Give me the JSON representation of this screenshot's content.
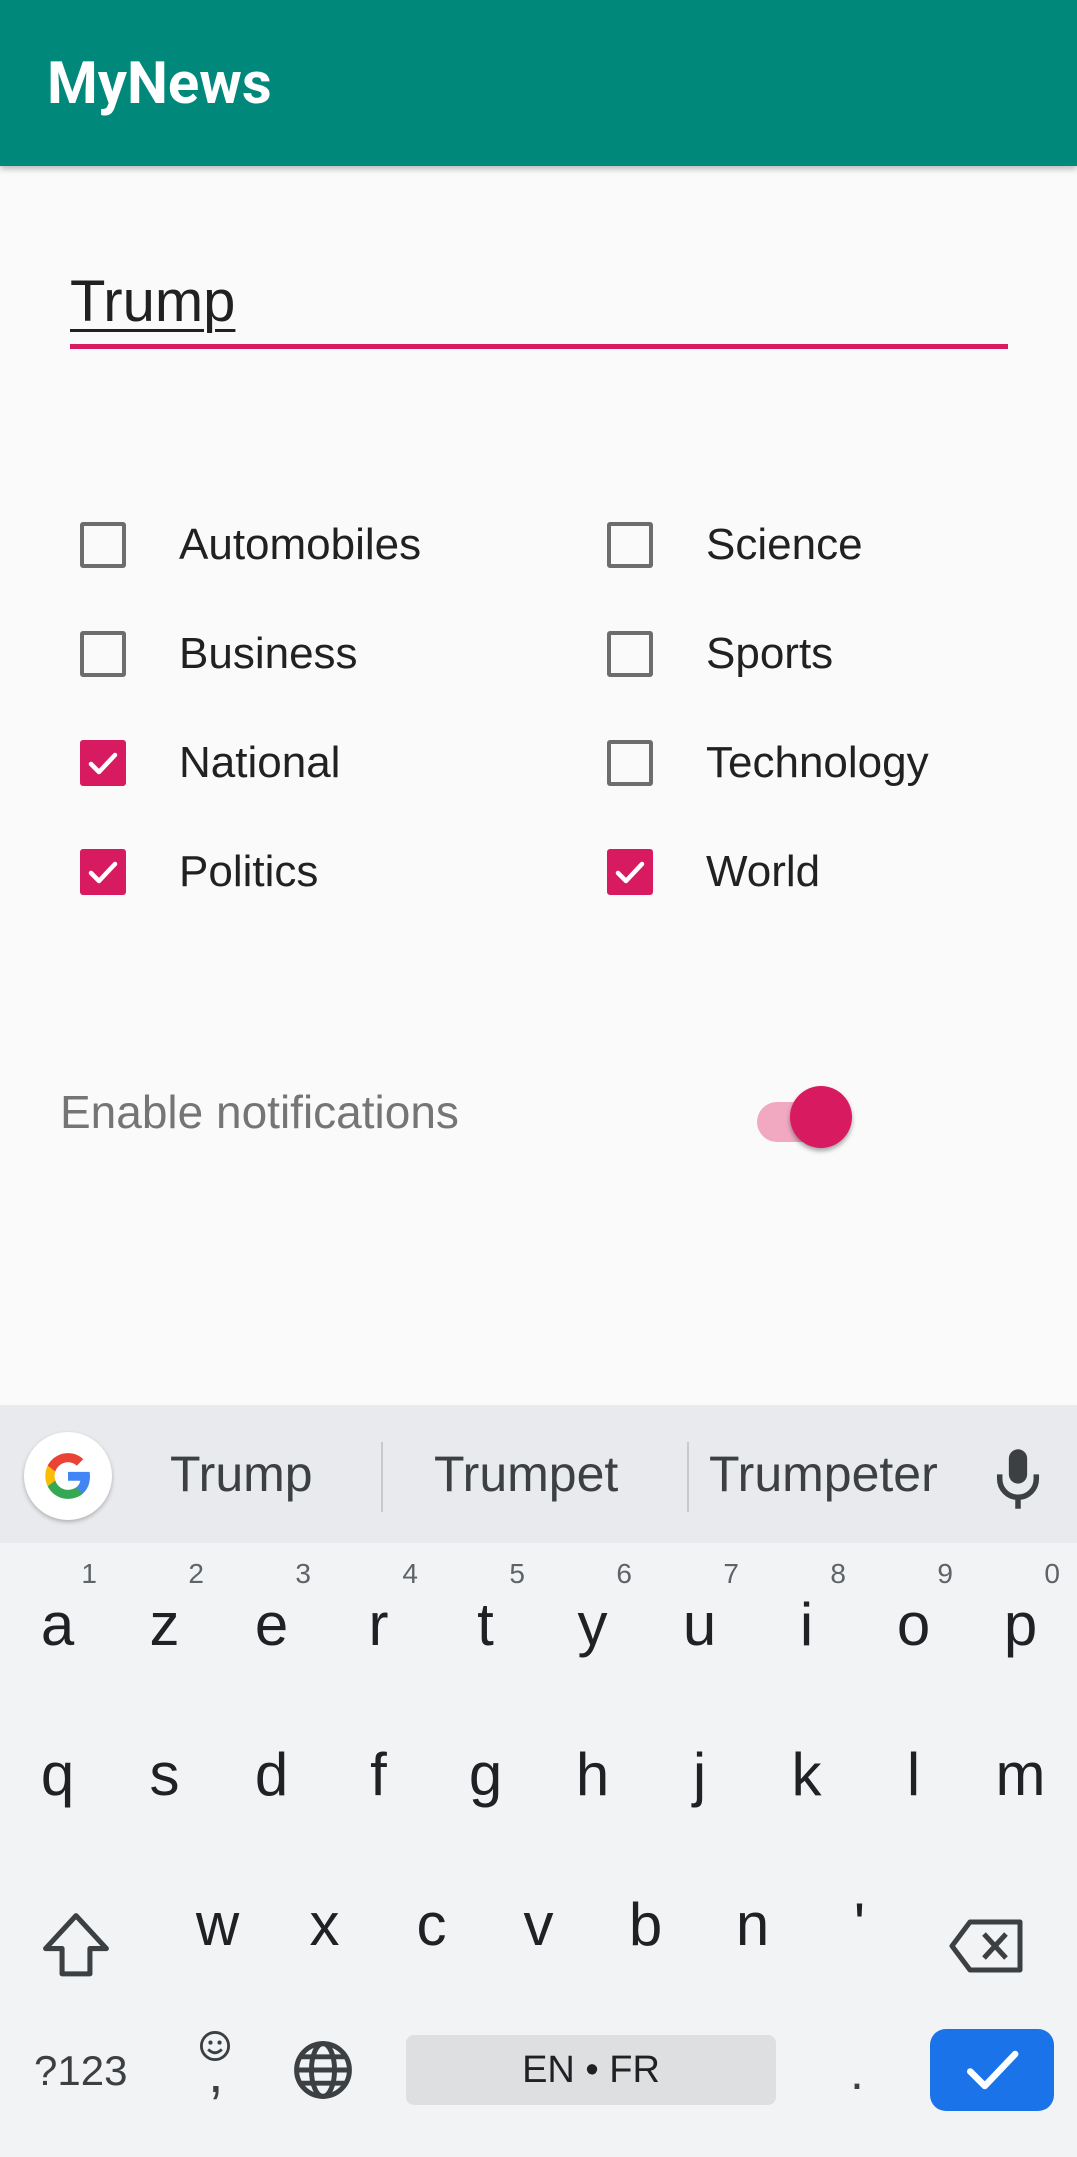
{
  "app_bar": {
    "title": "MyNews"
  },
  "search": {
    "value": "Trump"
  },
  "categories": [
    {
      "label": "Automobiles",
      "checked": false
    },
    {
      "label": "Science",
      "checked": false
    },
    {
      "label": "Business",
      "checked": false
    },
    {
      "label": "Sports",
      "checked": false
    },
    {
      "label": "National",
      "checked": true
    },
    {
      "label": "Technology",
      "checked": false
    },
    {
      "label": "Politics",
      "checked": true
    },
    {
      "label": "World",
      "checked": true
    }
  ],
  "notifications": {
    "label": "Enable notifications",
    "enabled": true
  },
  "keyboard": {
    "suggestions": [
      "Trump",
      "Trumpet",
      "Trumpeter"
    ],
    "row1": [
      {
        "ch": "a",
        "num": "1"
      },
      {
        "ch": "z",
        "num": "2"
      },
      {
        "ch": "e",
        "num": "3"
      },
      {
        "ch": "r",
        "num": "4"
      },
      {
        "ch": "t",
        "num": "5"
      },
      {
        "ch": "y",
        "num": "6"
      },
      {
        "ch": "u",
        "num": "7"
      },
      {
        "ch": "i",
        "num": "8"
      },
      {
        "ch": "o",
        "num": "9"
      },
      {
        "ch": "p",
        "num": "0"
      }
    ],
    "row2": [
      "q",
      "s",
      "d",
      "f",
      "g",
      "h",
      "j",
      "k",
      "l",
      "m"
    ],
    "row3": [
      "w",
      "x",
      "c",
      "v",
      "b",
      "n",
      "'"
    ],
    "symbols_label": "?123",
    "comma": ",",
    "space_label": "EN • FR",
    "period": "."
  },
  "colors": {
    "app_bar": "#00897b",
    "accent": "#d81b60",
    "enter_key": "#1a73e8"
  },
  "icons": {
    "google": "google-g-icon",
    "mic": "mic-icon",
    "shift": "shift-icon",
    "backspace": "backspace-icon",
    "emoji": "emoji-icon",
    "globe": "globe-icon",
    "enter": "check-icon"
  }
}
